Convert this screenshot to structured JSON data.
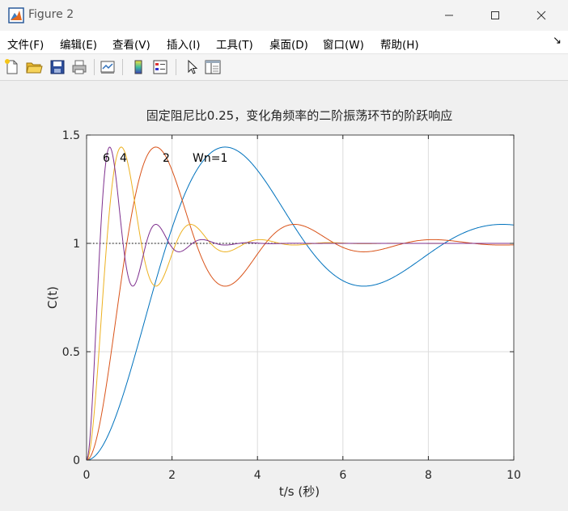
{
  "window": {
    "title": "Figure 2"
  },
  "menu": [
    "文件(F)",
    "编辑(E)",
    "查看(V)",
    "插入(I)",
    "工具(T)",
    "桌面(D)",
    "窗口(W)",
    "帮助(H)"
  ],
  "toolbar": [
    "new-figure",
    "open-file",
    "save",
    "print",
    "link-plot",
    "insert-colorbar",
    "insert-legend",
    "edit-plot",
    "property-inspector"
  ],
  "colors": {
    "wn1": "#0072bd",
    "wn2": "#d95319",
    "wn4": "#edb120",
    "wn6": "#7e2f8e",
    "axes_bg": "#ffffff",
    "grid": "#dcdcdc"
  },
  "chart_data": {
    "type": "line",
    "title": "固定阻尼比0.25，变化角频率的二阶振荡环节的阶跃响应",
    "xlabel": "t/s (秒)",
    "ylabel": "C(t)",
    "xlim": [
      0,
      10
    ],
    "ylim": [
      0,
      1.5
    ],
    "xticks": [
      "0",
      "2",
      "4",
      "6",
      "8",
      "10"
    ],
    "yticks": [
      "0",
      "0.5",
      "1",
      "1.5"
    ],
    "grid": true,
    "damping_ratio": 0.25,
    "reference_line": {
      "y": 1,
      "style": "dotted"
    },
    "annotations": [
      "6",
      "4",
      "2",
      "Wn=1"
    ],
    "series": [
      {
        "wn": 1,
        "peak_time": 3.24,
        "peak_value": 1.44
      },
      {
        "wn": 2,
        "peak_time": 1.62,
        "peak_value": 1.44
      },
      {
        "wn": 4,
        "peak_time": 0.81,
        "peak_value": 1.44
      },
      {
        "wn": 6,
        "peak_time": 0.54,
        "peak_value": 1.44
      }
    ]
  }
}
